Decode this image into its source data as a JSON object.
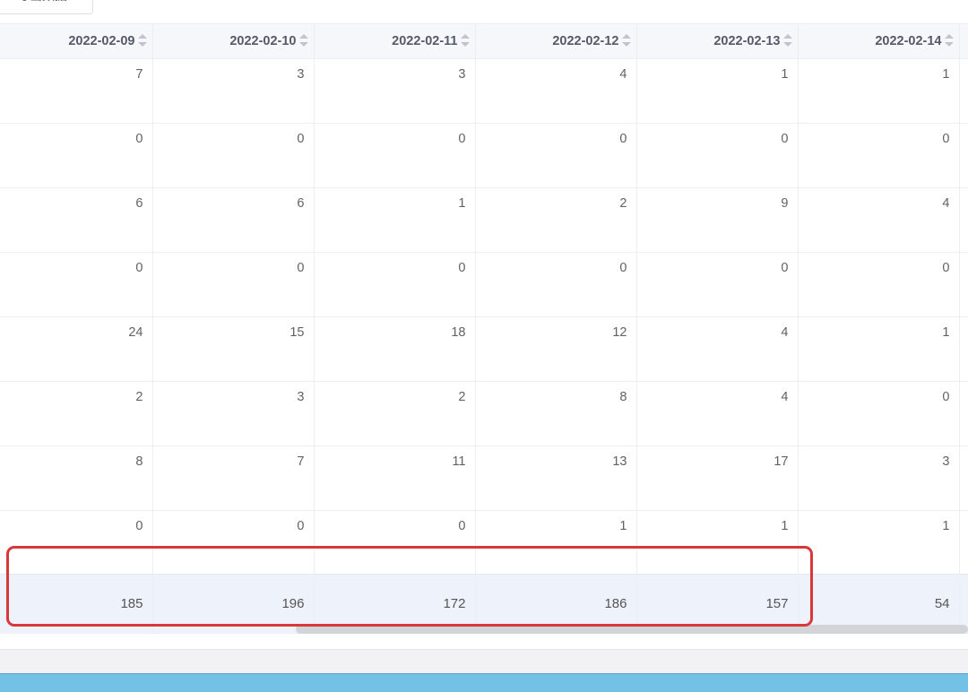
{
  "toolbar": {
    "export_label": "导出数据"
  },
  "table": {
    "columns": [
      {
        "label": "2022-02-09"
      },
      {
        "label": "2022-02-10"
      },
      {
        "label": "2022-02-11"
      },
      {
        "label": "2022-02-12"
      },
      {
        "label": "2022-02-13"
      },
      {
        "label": "2022-02-14"
      }
    ],
    "rows": [
      [
        "7",
        "3",
        "3",
        "4",
        "1",
        "1"
      ],
      [
        "0",
        "0",
        "0",
        "0",
        "0",
        "0"
      ],
      [
        "6",
        "6",
        "1",
        "2",
        "9",
        "4"
      ],
      [
        "0",
        "0",
        "0",
        "0",
        "0",
        "0"
      ],
      [
        "24",
        "15",
        "18",
        "12",
        "4",
        "1"
      ],
      [
        "2",
        "3",
        "2",
        "8",
        "4",
        "0"
      ],
      [
        "8",
        "7",
        "11",
        "13",
        "17",
        "3"
      ],
      [
        "0",
        "0",
        "0",
        "1",
        "1",
        "1"
      ]
    ],
    "totals": [
      "185",
      "196",
      "172",
      "186",
      "157",
      "54"
    ]
  },
  "colors": {
    "highlight": "#d9383a",
    "total_row_bg": "#eef2fb",
    "header_bg": "#f5f7fa",
    "bottom_strip": "#74c1e6"
  }
}
